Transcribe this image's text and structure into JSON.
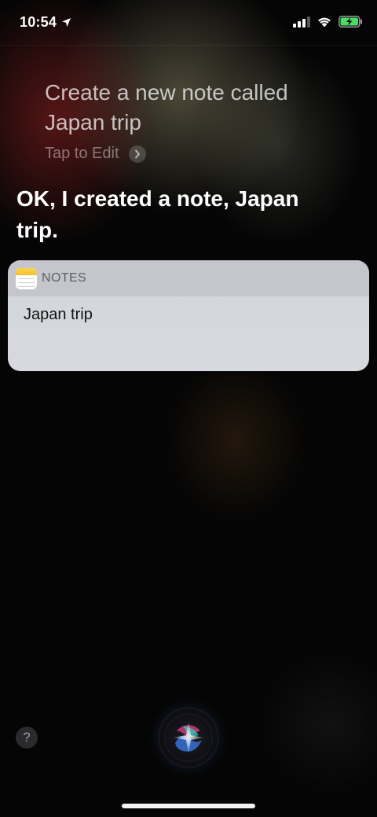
{
  "status_bar": {
    "time": "10:54",
    "icons": [
      "location-arrow-icon",
      "cellular-signal-icon",
      "wifi-icon",
      "battery-charging-icon"
    ]
  },
  "siri": {
    "query": "Create a new note called Japan trip",
    "tap_to_edit": "Tap to Edit",
    "response": "OK, I created a note, Japan trip."
  },
  "notes_card": {
    "app_label": "NOTES",
    "note_title": "Japan trip"
  },
  "bottom": {
    "help_label": "?"
  },
  "colors": {
    "battery_green": "#4cd964",
    "notes_yellow": "#f3c12b"
  }
}
